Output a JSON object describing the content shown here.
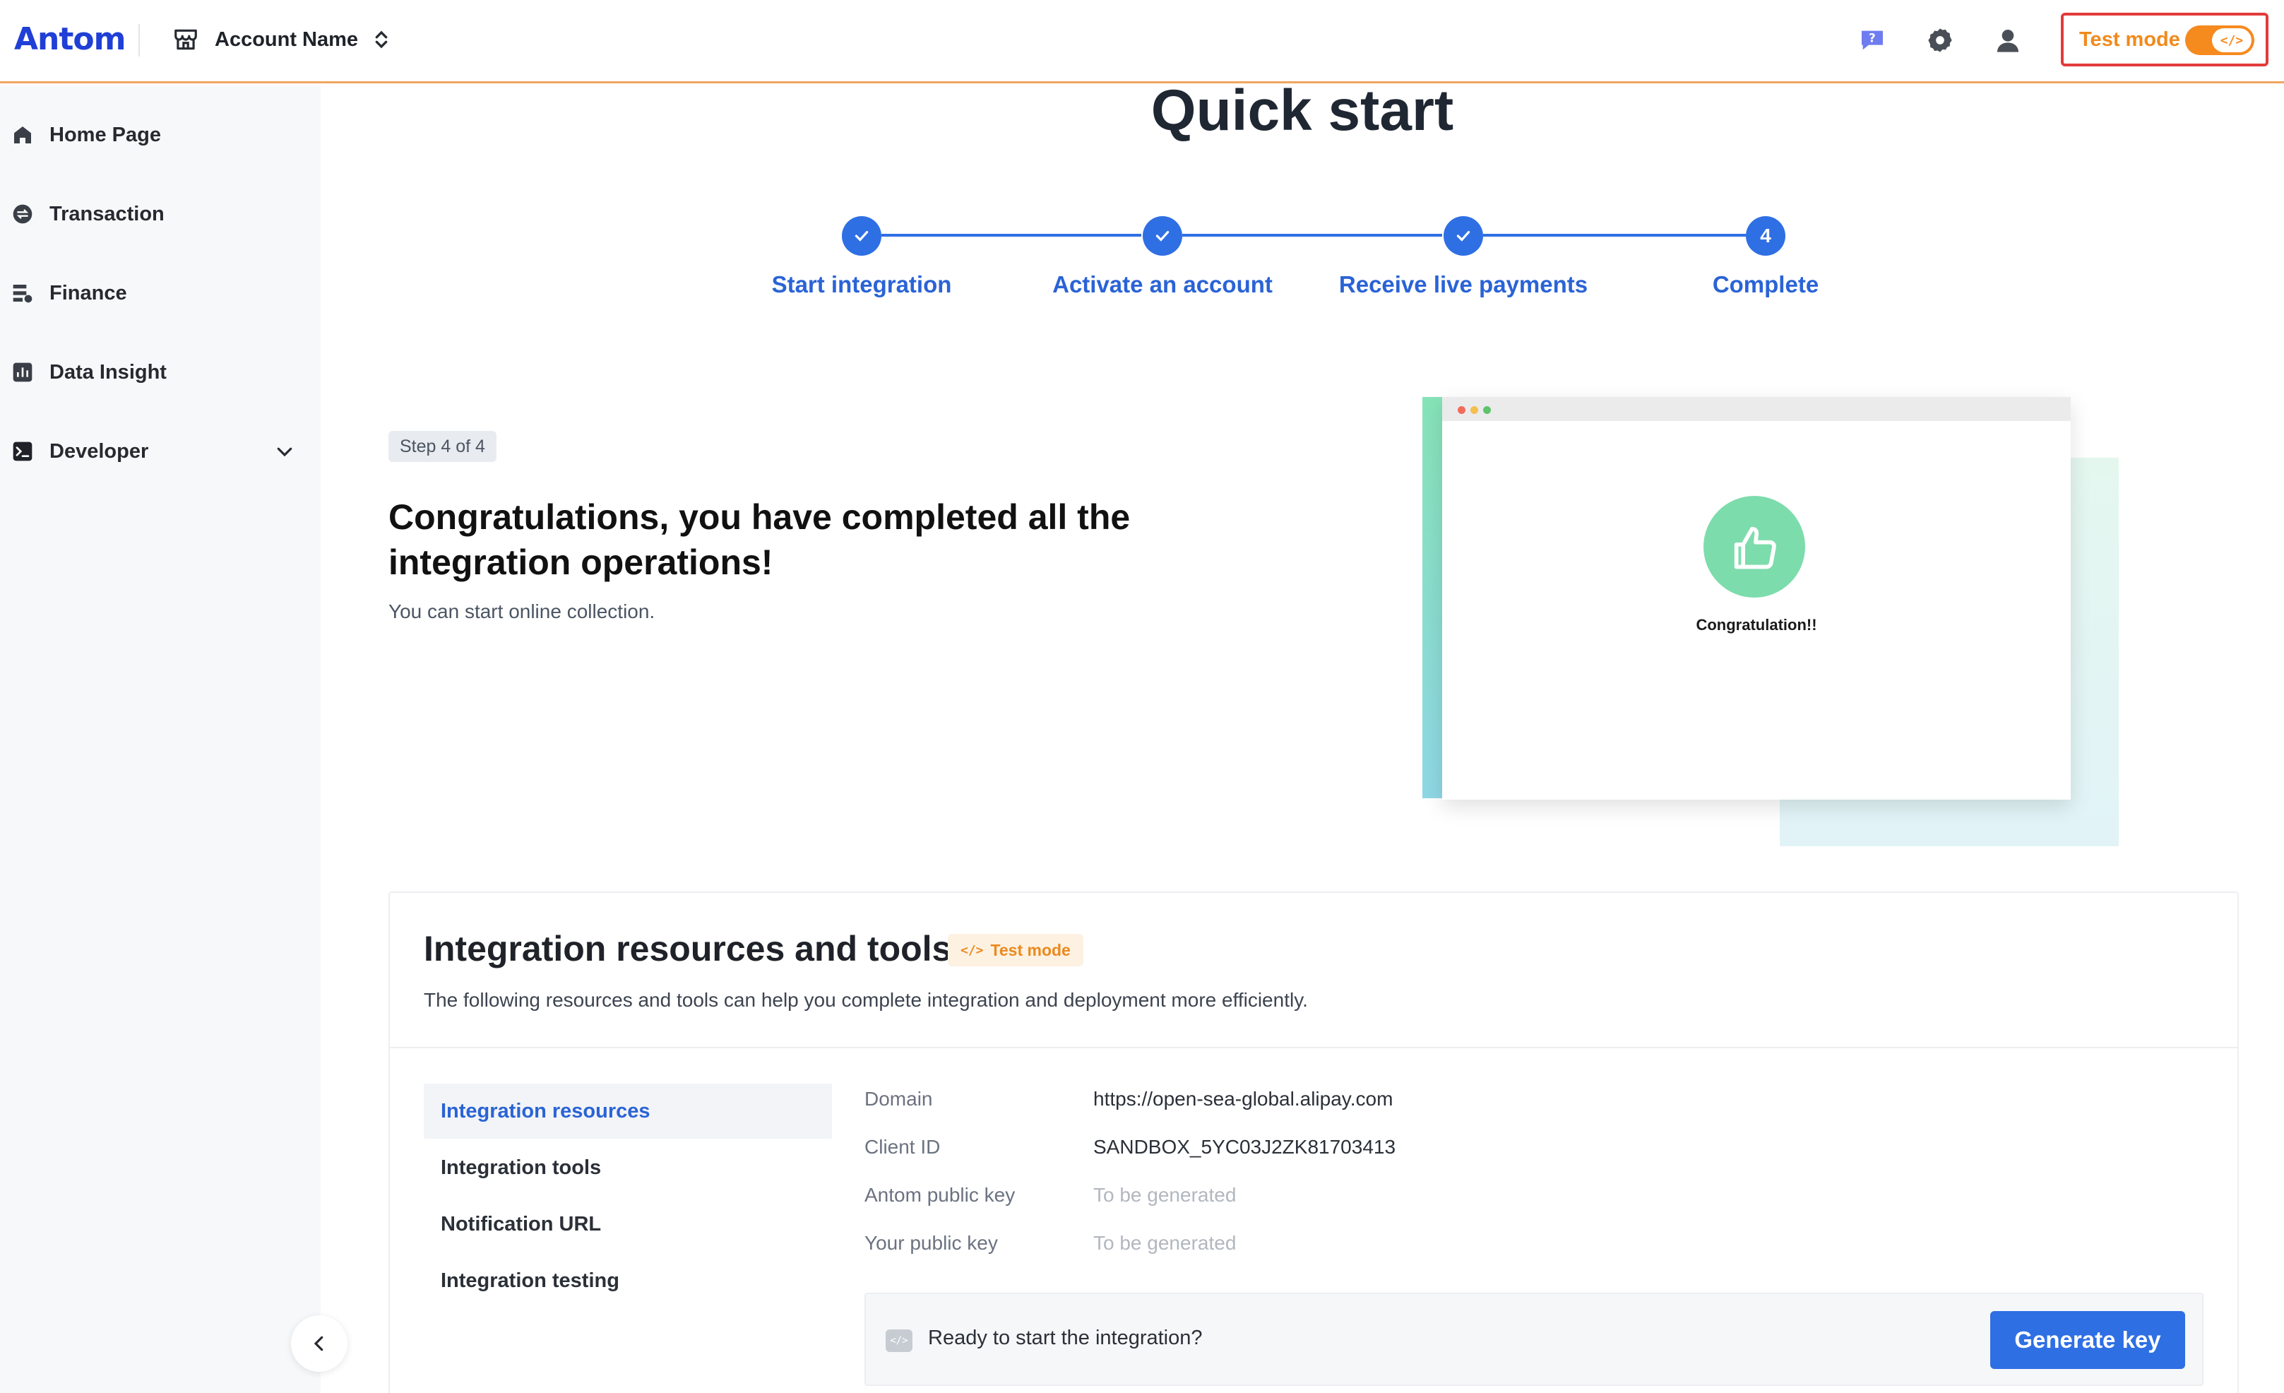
{
  "header": {
    "logo": "Antom",
    "account_name": "Account Name",
    "test_mode_label": "Test mode",
    "toggle_icon_text": "</>",
    "icons": [
      "help-chat-icon",
      "settings-gear-icon",
      "user-avatar-icon"
    ]
  },
  "sidebar": {
    "items": [
      {
        "label": "Home Page",
        "icon": "home-icon"
      },
      {
        "label": "Transaction",
        "icon": "transaction-icon"
      },
      {
        "label": "Finance",
        "icon": "finance-icon"
      },
      {
        "label": "Data Insight",
        "icon": "data-insight-icon"
      },
      {
        "label": "Developer",
        "icon": "developer-terminal-icon"
      }
    ]
  },
  "main": {
    "title": "Quick start",
    "steps": [
      {
        "label": "Start integration",
        "state": "done"
      },
      {
        "label": "Activate an account",
        "state": "done"
      },
      {
        "label": "Receive live payments",
        "state": "done"
      },
      {
        "label": "Complete",
        "state": "current",
        "number": "4"
      }
    ],
    "step_badge": "Step 4 of 4",
    "congrats_heading": "Congratulations, you have completed all the integration operations!",
    "congrats_text": "You can start online collection.",
    "illustration_text": "Congratulation!!"
  },
  "resources": {
    "title": "Integration resources and tools",
    "badge": "Test mode",
    "badge_icon_text": "</>",
    "description": "The following resources and tools can help you complete integration and deployment more efficiently.",
    "tabs": [
      "Integration resources",
      "Integration tools",
      "Notification URL",
      "Integration testing"
    ],
    "fields": [
      {
        "key": "Domain",
        "value": "https://open-sea-global.alipay.com"
      },
      {
        "key": "Client ID",
        "value": "SANDBOX_5YC03J2ZK81703413"
      },
      {
        "key": "Antom public key",
        "value": "To be generated"
      },
      {
        "key": "Your public key",
        "value": "To be generated"
      }
    ],
    "ready_icon_text": "</>",
    "ready_text": "Ready to start the integration?",
    "generate_button": "Generate key"
  },
  "colors": {
    "primary": "#2f6fe4",
    "test_mode_orange": "#f58a1f",
    "highlight_border": "#e23b3b",
    "success_green": "#7ddcac"
  }
}
